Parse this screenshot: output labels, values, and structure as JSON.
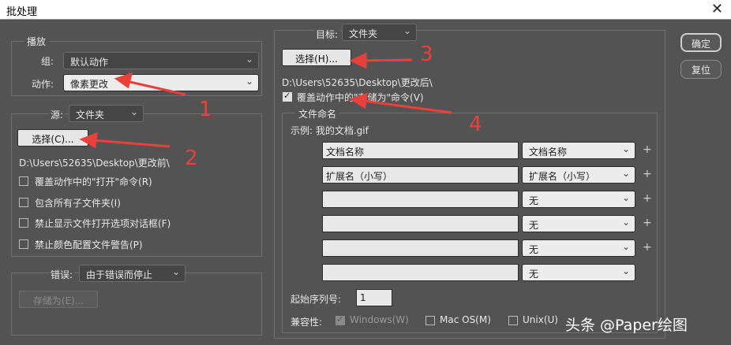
{
  "window": {
    "title": "批处理",
    "close_glyph": "✕"
  },
  "play": {
    "legend": "播放",
    "group_label": "组:",
    "group_value": "默认动作",
    "action_label": "动作:",
    "action_value": "像素更改"
  },
  "source": {
    "label": "源:",
    "value": "文件夹",
    "choose_label": "选择(C)...",
    "path": "D:\\Users\\52635\\Desktop\\更改前\\",
    "options": [
      {
        "label": "覆盖动作中的\"打开\"命令(R)",
        "checked": false
      },
      {
        "label": "包含所有子文件夹(I)",
        "checked": false
      },
      {
        "label": "禁止显示文件打开选项对话框(F)",
        "checked": false
      },
      {
        "label": "禁止颜色配置文件警告(P)",
        "checked": false
      }
    ]
  },
  "errors": {
    "label": "错误:",
    "value": "由于错误而停止",
    "save_as_label": "存储为(E)..."
  },
  "target": {
    "label": "目标:",
    "value": "文件夹",
    "choose_label": "选择(H)...",
    "path": "D:\\Users\\52635\\Desktop\\更改后\\",
    "override_label": "覆盖动作中的\"存储为\"命令(V)",
    "override_checked": true
  },
  "naming": {
    "legend": "文件命名",
    "example": "示例: 我的文档.gif",
    "rows": [
      {
        "text": "文档名称",
        "select": "文档名称",
        "plus": true
      },
      {
        "text": "扩展名（小写）",
        "select": "扩展名（小写）",
        "plus": true
      },
      {
        "text": "",
        "select": "无",
        "plus": true
      },
      {
        "text": "",
        "select": "无",
        "plus": true
      },
      {
        "text": "",
        "select": "无",
        "plus": true
      },
      {
        "text": "",
        "select": "无",
        "plus": false
      }
    ],
    "serial_label": "起始序列号:",
    "serial_value": "1",
    "compat_label": "兼容性:",
    "compat": [
      {
        "label": "Windows(W)",
        "checked": true,
        "disabled": true
      },
      {
        "label": "Mac OS(M)",
        "checked": false,
        "disabled": false
      },
      {
        "label": "Unix(U)",
        "checked": false,
        "disabled": false
      }
    ]
  },
  "buttons": {
    "ok": "确定",
    "reset": "复位"
  },
  "annotations": [
    "1",
    "2",
    "3",
    "4"
  ],
  "watermark": "头条 @Paper绘图"
}
